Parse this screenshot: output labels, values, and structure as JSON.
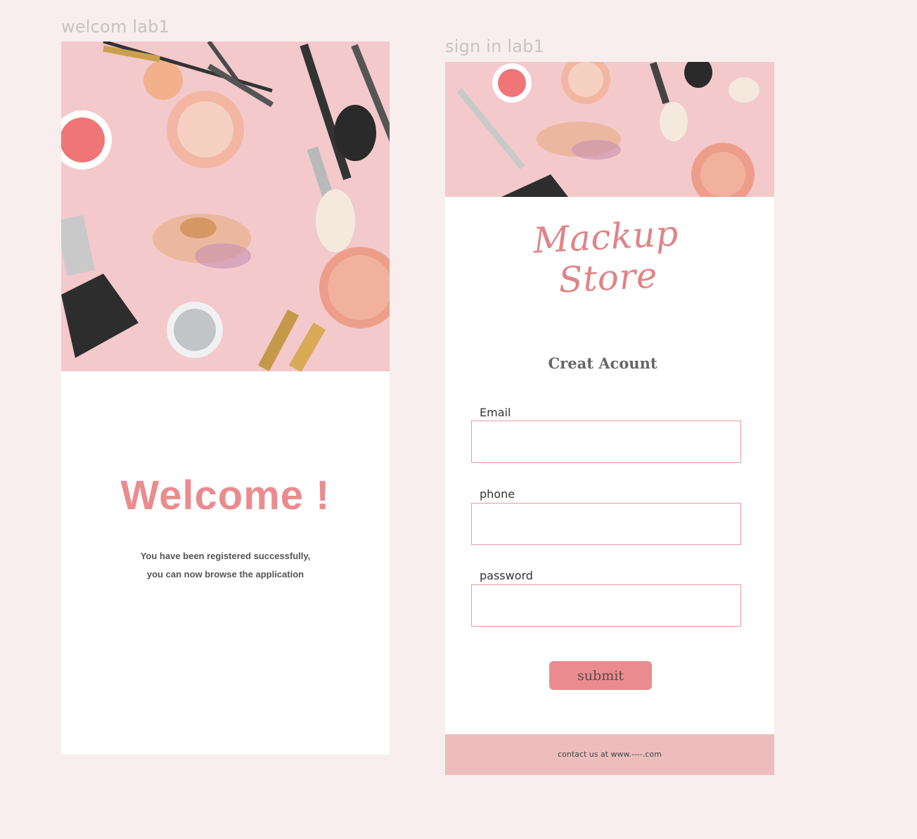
{
  "frames": {
    "welcome_label": "welcom lab1",
    "signin_label": "sign in lab1"
  },
  "welcome": {
    "title": "Welcome !",
    "message_line1": "You have been registered successfully,",
    "message_line2": "you can now browse the application"
  },
  "signin": {
    "brand": "Mackup Store",
    "section_title": "Creat Acount",
    "fields": [
      {
        "label": "Email",
        "value": ""
      },
      {
        "label": "phone",
        "value": ""
      },
      {
        "label": "password",
        "value": ""
      }
    ],
    "submit_label": "submit",
    "footer_text": "contact us at www.----.com"
  },
  "colors": {
    "accent": "#ea8c8f",
    "page_background": "#f8eeee",
    "hero_background": "#f3c9cc",
    "footer_background": "#edbdbd",
    "input_border": "#e39aa0"
  },
  "images": {
    "hero": "makeup-flatlay-image"
  }
}
